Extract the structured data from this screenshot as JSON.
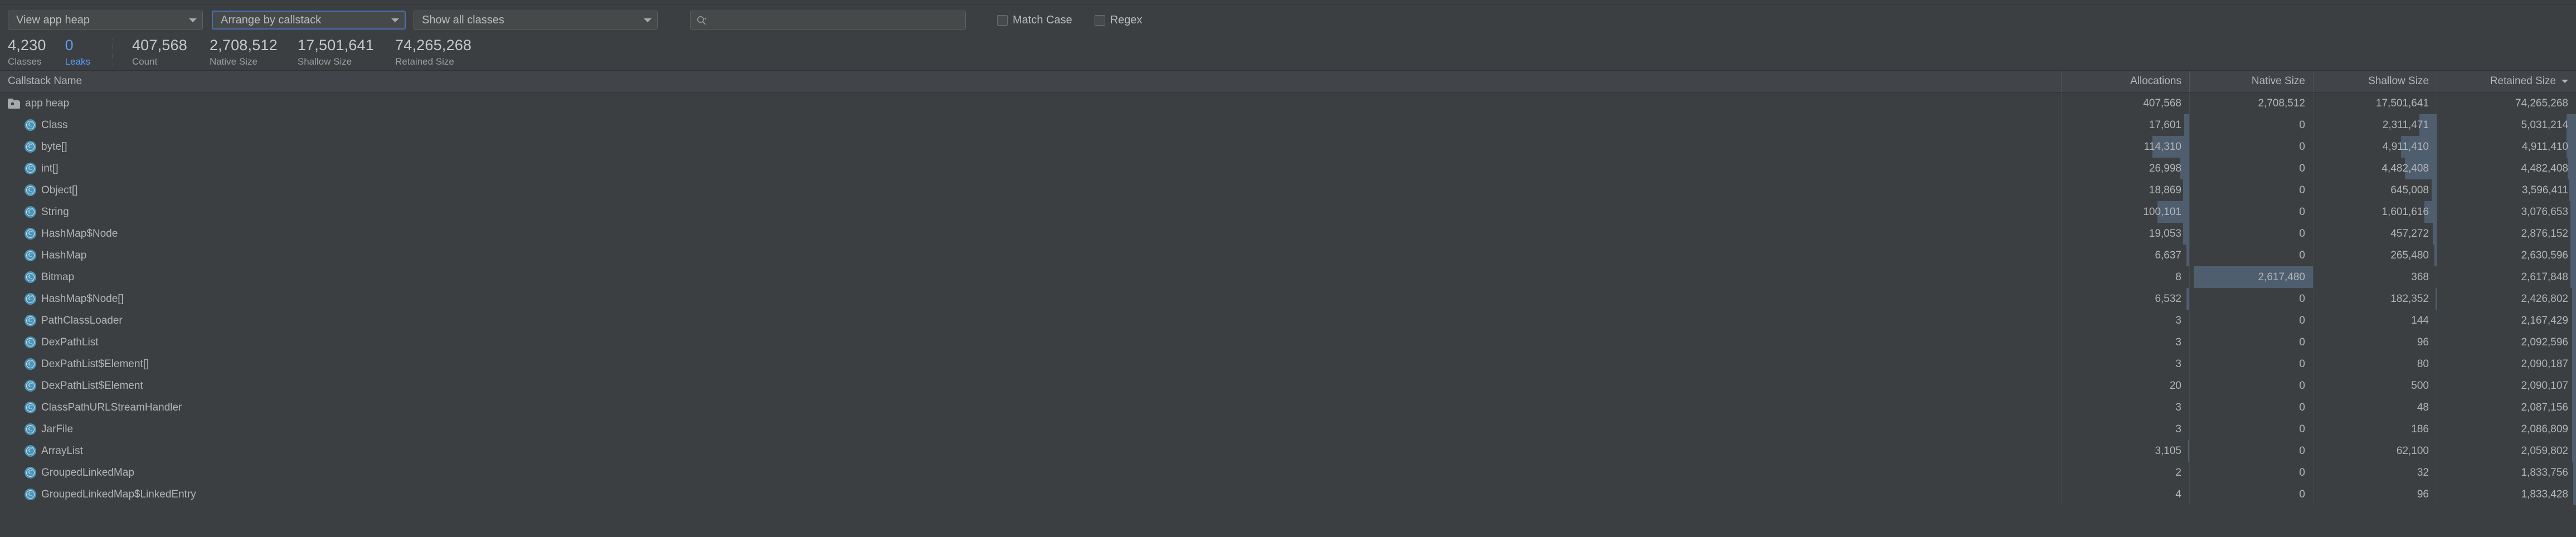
{
  "toolbar": {
    "heap_select": {
      "value": "View app heap",
      "icon": "chevron-down-icon"
    },
    "arrange_select": {
      "value": "Arrange by callstack",
      "icon": "chevron-down-icon"
    },
    "classes_select": {
      "value": "Show all classes",
      "icon": "chevron-down-icon"
    },
    "search": {
      "value": "",
      "placeholder": "",
      "icon": "search-icon"
    },
    "match_case_label": "Match Case",
    "regex_label": "Regex",
    "accent_focus_color": "#4b6eaf"
  },
  "stats": [
    {
      "value": "4,230",
      "caption": "Classes",
      "color": "#c8c8c8"
    },
    {
      "value": "0",
      "caption": "Leaks",
      "color": "#589df6"
    },
    {
      "value": "407,568",
      "caption": "Count",
      "color": "#c8c8c8"
    },
    {
      "value": "2,708,512",
      "caption": "Native Size",
      "color": "#c8c8c8"
    },
    {
      "value": "17,501,641",
      "caption": "Shallow Size",
      "color": "#c8c8c8"
    },
    {
      "value": "74,265,268",
      "caption": "Retained Size",
      "color": "#c8c8c8"
    }
  ],
  "table": {
    "columns": [
      {
        "key": "name",
        "label": "Callstack Name",
        "align": "left"
      },
      {
        "key": "alloc",
        "label": "Allocations",
        "align": "right"
      },
      {
        "key": "native",
        "label": "Native Size",
        "align": "right"
      },
      {
        "key": "shallow",
        "label": "Shallow Size",
        "align": "right"
      },
      {
        "key": "retained",
        "label": "Retained Size",
        "align": "right",
        "sort": "desc",
        "sort_icon": "caret-down-icon"
      }
    ],
    "rows": [
      {
        "name": "app heap",
        "icon": "folder-icon",
        "depth": 0,
        "alloc": "407,568",
        "native": "2,708,512",
        "shallow": "17,501,641",
        "retained": "74,265,268",
        "bars": {
          "alloc": 0,
          "native": 0,
          "shallow": 0,
          "retained": 0
        }
      },
      {
        "name": "Class",
        "icon": "class-icon",
        "depth": 1,
        "alloc": "17,601",
        "native": "0",
        "shallow": "2,311,471",
        "retained": "5,031,214",
        "bars": {
          "alloc": 4,
          "native": 0,
          "shallow": 14,
          "retained": 7
        }
      },
      {
        "name": "byte[]",
        "icon": "class-icon",
        "depth": 1,
        "alloc": "114,310",
        "native": "0",
        "shallow": "4,911,410",
        "retained": "4,911,410",
        "bars": {
          "alloc": 29,
          "native": 0,
          "shallow": 29,
          "retained": 7
        }
      },
      {
        "name": "int[]",
        "icon": "class-icon",
        "depth": 1,
        "alloc": "26,998",
        "native": "0",
        "shallow": "4,482,408",
        "retained": "4,482,408",
        "bars": {
          "alloc": 7,
          "native": 0,
          "shallow": 26,
          "retained": 6
        }
      },
      {
        "name": "Object[]",
        "icon": "class-icon",
        "depth": 1,
        "alloc": "18,869",
        "native": "0",
        "shallow": "645,008",
        "retained": "3,596,411",
        "bars": {
          "alloc": 5,
          "native": 0,
          "shallow": 4,
          "retained": 5
        }
      },
      {
        "name": "String",
        "icon": "class-icon",
        "depth": 1,
        "alloc": "100,101",
        "native": "0",
        "shallow": "1,601,616",
        "retained": "3,076,653",
        "bars": {
          "alloc": 25,
          "native": 0,
          "shallow": 10,
          "retained": 4
        }
      },
      {
        "name": "HashMap$Node",
        "icon": "class-icon",
        "depth": 1,
        "alloc": "19,053",
        "native": "0",
        "shallow": "457,272",
        "retained": "2,876,152",
        "bars": {
          "alloc": 5,
          "native": 0,
          "shallow": 3,
          "retained": 4
        }
      },
      {
        "name": "HashMap",
        "icon": "class-icon",
        "depth": 1,
        "alloc": "6,637",
        "native": "0",
        "shallow": "265,480",
        "retained": "2,630,596",
        "bars": {
          "alloc": 2,
          "native": 0,
          "shallow": 2,
          "retained": 4
        }
      },
      {
        "name": "Bitmap",
        "icon": "class-icon",
        "depth": 1,
        "alloc": "8",
        "native": "2,617,480",
        "shallow": "368",
        "retained": "2,617,848",
        "bars": {
          "alloc": 0,
          "native": 97,
          "shallow": 0,
          "retained": 4
        }
      },
      {
        "name": "HashMap$Node[]",
        "icon": "class-icon",
        "depth": 1,
        "alloc": "6,532",
        "native": "0",
        "shallow": "182,352",
        "retained": "2,426,802",
        "bars": {
          "alloc": 2,
          "native": 0,
          "shallow": 1,
          "retained": 3
        }
      },
      {
        "name": "PathClassLoader",
        "icon": "class-icon",
        "depth": 1,
        "alloc": "3",
        "native": "0",
        "shallow": "144",
        "retained": "2,167,429",
        "bars": {
          "alloc": 0,
          "native": 0,
          "shallow": 0,
          "retained": 3
        }
      },
      {
        "name": "DexPathList",
        "icon": "class-icon",
        "depth": 1,
        "alloc": "3",
        "native": "0",
        "shallow": "96",
        "retained": "2,092,596",
        "bars": {
          "alloc": 0,
          "native": 0,
          "shallow": 0,
          "retained": 3
        }
      },
      {
        "name": "DexPathList$Element[]",
        "icon": "class-icon",
        "depth": 1,
        "alloc": "3",
        "native": "0",
        "shallow": "80",
        "retained": "2,090,187",
        "bars": {
          "alloc": 0,
          "native": 0,
          "shallow": 0,
          "retained": 3
        }
      },
      {
        "name": "DexPathList$Element",
        "icon": "class-icon",
        "depth": 1,
        "alloc": "20",
        "native": "0",
        "shallow": "500",
        "retained": "2,090,107",
        "bars": {
          "alloc": 0,
          "native": 0,
          "shallow": 0,
          "retained": 3
        }
      },
      {
        "name": "ClassPathURLStreamHandler",
        "icon": "class-icon",
        "depth": 1,
        "alloc": "3",
        "native": "0",
        "shallow": "48",
        "retained": "2,087,156",
        "bars": {
          "alloc": 0,
          "native": 0,
          "shallow": 0,
          "retained": 3
        }
      },
      {
        "name": "JarFile",
        "icon": "class-icon",
        "depth": 1,
        "alloc": "3",
        "native": "0",
        "shallow": "186",
        "retained": "2,086,809",
        "bars": {
          "alloc": 0,
          "native": 0,
          "shallow": 0,
          "retained": 3
        }
      },
      {
        "name": "ArrayList",
        "icon": "class-icon",
        "depth": 1,
        "alloc": "3,105",
        "native": "0",
        "shallow": "62,100",
        "retained": "2,059,802",
        "bars": {
          "alloc": 1,
          "native": 0,
          "shallow": 0,
          "retained": 3
        }
      },
      {
        "name": "GroupedLinkedMap",
        "icon": "class-icon",
        "depth": 1,
        "alloc": "2",
        "native": "0",
        "shallow": "32",
        "retained": "1,833,756",
        "bars": {
          "alloc": 0,
          "native": 0,
          "shallow": 0,
          "retained": 2
        }
      },
      {
        "name": "GroupedLinkedMap$LinkedEntry",
        "icon": "class-icon",
        "depth": 1,
        "alloc": "4",
        "native": "0",
        "shallow": "96",
        "retained": "1,833,428",
        "bars": {
          "alloc": 0,
          "native": 0,
          "shallow": 0,
          "retained": 2
        }
      }
    ]
  }
}
